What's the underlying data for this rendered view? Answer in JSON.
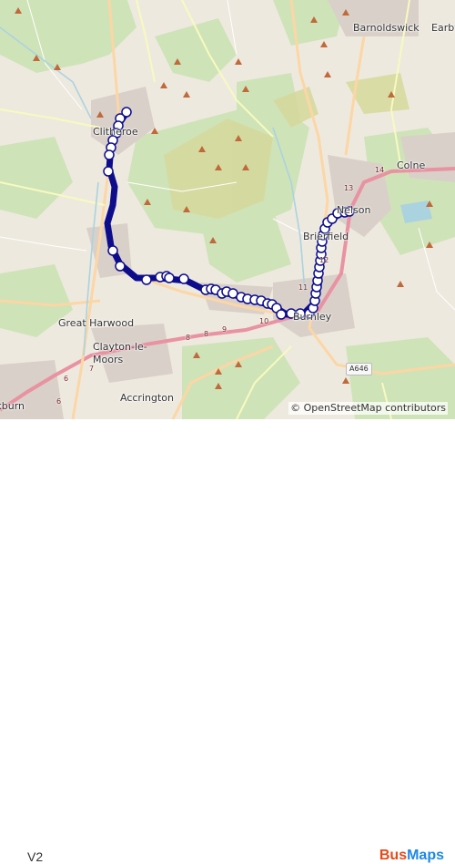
{
  "map": {
    "places": [
      {
        "name": "Barnoldswick"
      },
      {
        "name": "Earby"
      },
      {
        "name": "Clitheroe"
      },
      {
        "name": "Colne"
      },
      {
        "name": "Nelson"
      },
      {
        "name": "Brierfield"
      },
      {
        "name": "Burnley"
      },
      {
        "name": "Great Harwood"
      },
      {
        "name": "Clayton-le-\nMoors"
      },
      {
        "name": "Accrington"
      },
      {
        "name": "Blackburn"
      }
    ],
    "road_numbers": [
      "14",
      "13",
      "12",
      "11",
      "10",
      "9",
      "8",
      "8",
      "7",
      "6",
      "6"
    ],
    "road_badge": "A646",
    "attribution_symbol": "©",
    "attribution_text": "OpenStreetMap contributors"
  },
  "route": {
    "label": "V2",
    "color": "#0d0d8c",
    "stop_color": "#ffffff"
  },
  "brand": {
    "part1": "Bus",
    "part2": "Maps"
  }
}
